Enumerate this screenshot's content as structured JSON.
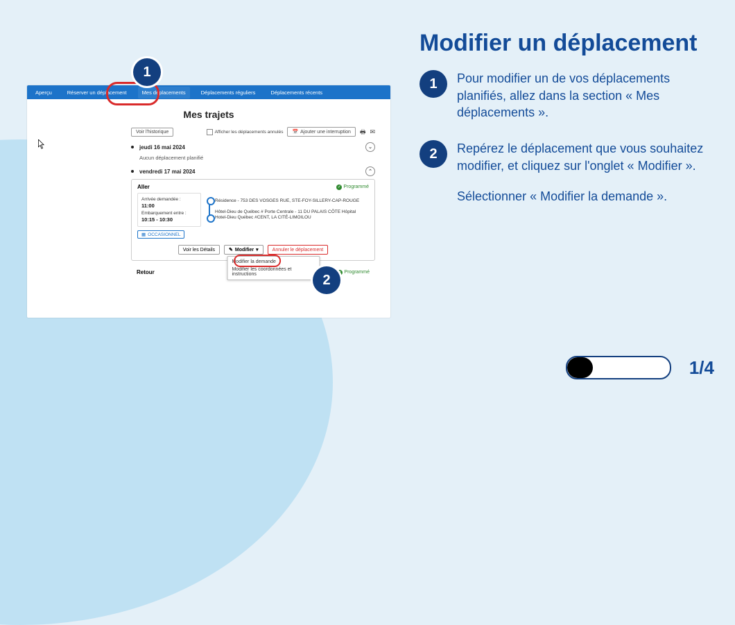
{
  "slide": {
    "title": "Modifier un déplacement",
    "steps": [
      {
        "num": "1",
        "text": "Pour modifier un de vos déplacements planifiés, allez dans la section « Mes déplacements »."
      },
      {
        "num": "2",
        "text": "Repérez le déplacement que vous souhaitez modifier, et cliquez sur l'onglet « Modifier ».",
        "extra": "Sélectionner « Modifier la demande »."
      }
    ],
    "page_indicator": "1/4",
    "progress_fraction": 0.25
  },
  "app": {
    "nav": {
      "items": [
        "Aperçu",
        "Réserver un déplacement",
        "Mes déplacements",
        "Déplacements réguliers",
        "Déplacements récents"
      ],
      "active_index": 2
    },
    "page_title": "Mes trajets",
    "toolbar": {
      "history_btn": "Voir l'historique",
      "show_cancelled_label": "Afficher les déplacements annulés",
      "add_interruption_btn": "Ajouter une interruption"
    },
    "days": [
      {
        "label": "jeudi 16 mai 2024",
        "expanded": false,
        "empty_text": "Aucun déplacement planifié"
      },
      {
        "label": "vendredi 17 mai 2024",
        "expanded": true
      }
    ],
    "trip": {
      "direction_label": "Aller",
      "return_label": "Retour",
      "status": "Programmé",
      "times": {
        "arrival_requested_label": "Arrivée demandée :",
        "arrival_requested_value": "11:00",
        "boarding_label": "Embarquement entre :",
        "boarding_value": "10:15 - 10:30"
      },
      "stops": [
        "Résidence - 753 DES VOSGES RUE, STE-FOY-SILLERY-CAP-ROUGE",
        "Hôtel-Dieu de Québec # Porte Centrale - 11 DU PALAIS CÔTE Hôpital Hotel-Dieu Québec #CENT, LA CITÉ-LIMOILOU"
      ],
      "tag": "OCCASIONNEL",
      "actions": {
        "details": "Voir les Détails",
        "modify": "Modifier",
        "cancel": "Annuler le déplacement",
        "dropdown": [
          "Modifier la demande",
          "Modifier les coordonnées et instructions"
        ]
      }
    }
  },
  "annotations": {
    "badge1": "1",
    "badge2": "2"
  },
  "colors": {
    "brand_blue": "#134b98",
    "badge_blue": "#133f7f",
    "topbar_blue": "#1c73c9",
    "highlight_red": "#d92a2a",
    "status_green": "#2f8a2f"
  }
}
